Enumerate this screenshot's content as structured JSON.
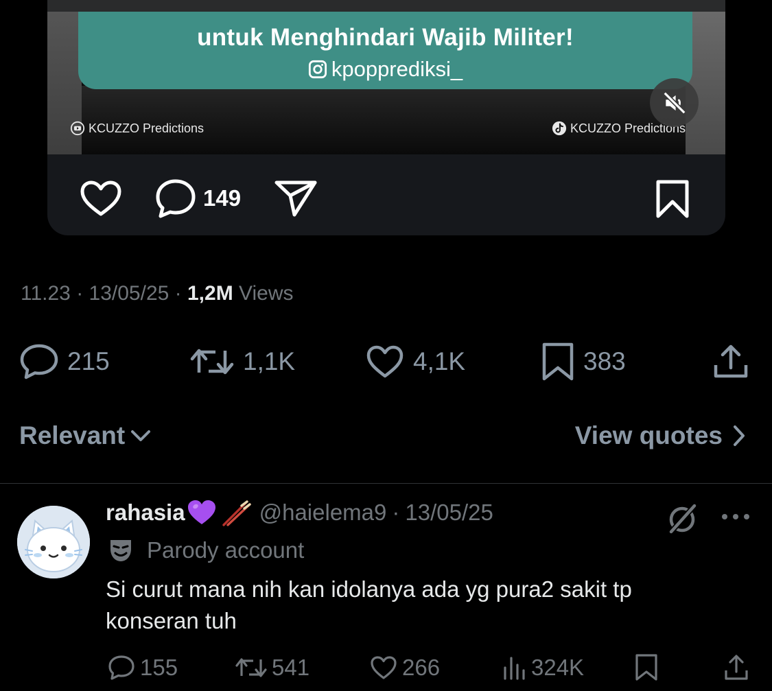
{
  "media": {
    "banner_text": "untuk Menghindari Wajib Militer!",
    "banner_handle": "kpopprediksi_",
    "watermark_left": "KCUZZO Predictions",
    "watermark_right": "KCUZZO Predictions",
    "comment_count": "149",
    "colors": {
      "banner": "#3f8f86",
      "card": "#16181c"
    }
  },
  "tweet": {
    "time": "11.23",
    "date": "13/05/25",
    "views_count": "1,2M",
    "views_label": "Views",
    "stats": {
      "replies": "215",
      "reposts": "1,1K",
      "likes": "4,1K",
      "bookmarks": "383"
    }
  },
  "sort": {
    "relevant_label": "Relevant",
    "view_quotes_label": "View quotes"
  },
  "reply": {
    "name": "rahasia",
    "handle": "@haielema9",
    "date": "13/05/25",
    "badge_label": "Parody account",
    "text": "Si curut mana nih kan idolanya ada yg pura2 sakit tp konseran tuh",
    "stats": {
      "replies": "155",
      "reposts": "541",
      "likes": "266",
      "views": "324K"
    },
    "icons": [
      "purple-heart-icon",
      "chopsticks-icon",
      "theater-mask-icon",
      "grok-icon",
      "more-icon"
    ]
  },
  "colors": {
    "background": "#000000",
    "text_primary": "#e7e9ea",
    "text_secondary": "#71767b",
    "divider": "#2f3336"
  }
}
